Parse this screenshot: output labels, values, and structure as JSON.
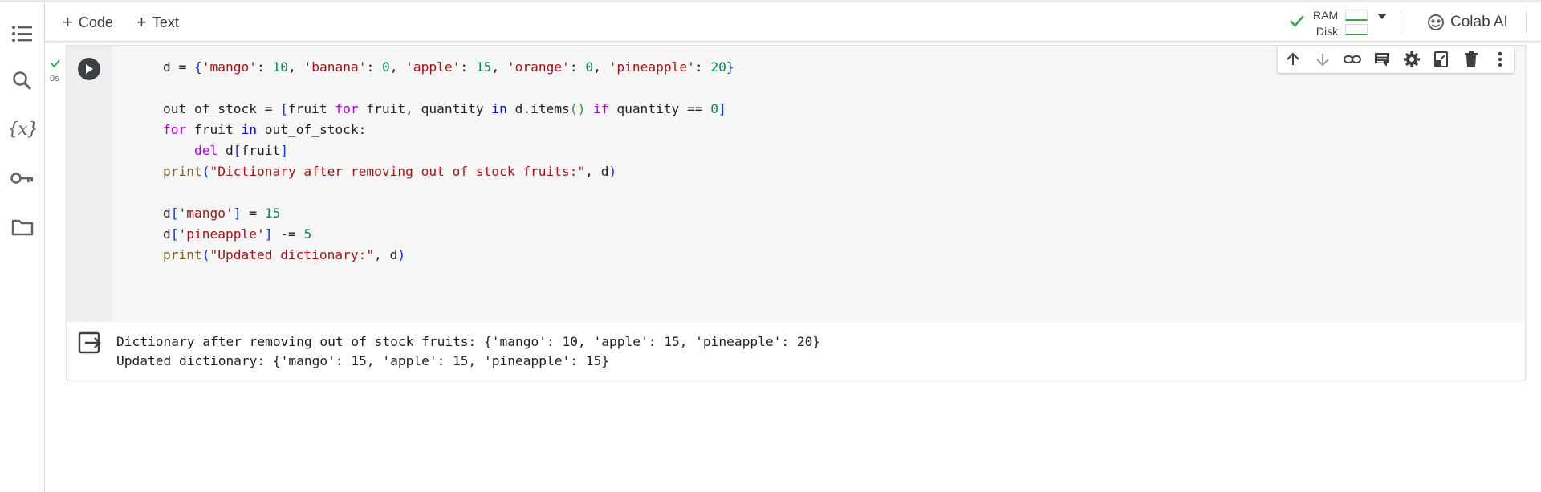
{
  "toolbar": {
    "add_code": "Code",
    "add_text": "Text",
    "ram_label": "RAM",
    "disk_label": "Disk",
    "colab_ai": "Colab AI"
  },
  "sidebar": {
    "items": [
      "table-of-contents",
      "find-and-replace",
      "variables",
      "secrets",
      "files"
    ],
    "variables_glyph": "{x}"
  },
  "cell": {
    "exec_time": "0s",
    "code_lines": [
      "d = {'mango': 10, 'banana': 0, 'apple': 15, 'orange': 0, 'pineapple': 20}",
      "",
      "out_of_stock = [fruit for fruit, quantity in d.items() if quantity == 0]",
      "for fruit in out_of_stock:",
      "    del d[fruit]",
      "print(\"Dictionary after removing out of stock fruits:\", d)",
      "",
      "d['mango'] = 15",
      "d['pineapple'] -= 5",
      "print(\"Updated dictionary:\", d)"
    ],
    "output_lines": [
      "Dictionary after removing out of stock fruits: {'mango': 10, 'apple': 15, 'pineapple': 20}",
      "Updated dictionary: {'mango': 15, 'apple': 15, 'pineapple': 15}"
    ],
    "cell_toolbar": [
      "move-up-icon",
      "move-down-icon",
      "link-icon",
      "comment-icon",
      "settings-icon",
      "mirror-cell-icon",
      "delete-icon",
      "more-icon"
    ]
  },
  "colors": {
    "keyword": "#af00db",
    "builtin_keyword": "#0000ff",
    "string": "#a31515",
    "number": "#098658",
    "function": "#795e26",
    "success": "#34a853"
  }
}
